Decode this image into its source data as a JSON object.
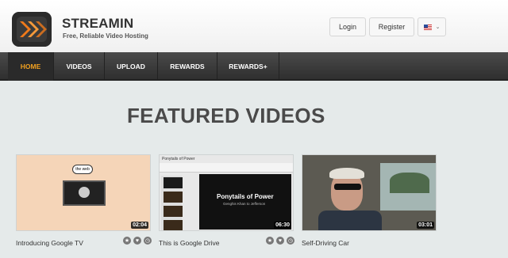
{
  "brand": {
    "name": "STREAMIN",
    "tagline": "Free, Reliable Video Hosting",
    "logo_colors": [
      "#2b2b2b",
      "#f07a1a"
    ]
  },
  "header": {
    "login_label": "Login",
    "register_label": "Register",
    "language_icon": "us-flag-icon"
  },
  "nav": {
    "items": [
      {
        "label": "HOME",
        "active": true
      },
      {
        "label": "VIDEOS",
        "active": false
      },
      {
        "label": "UPLOAD",
        "active": false
      },
      {
        "label": "REWARDS",
        "active": false
      },
      {
        "label": "REWARDS+",
        "active": false
      }
    ]
  },
  "featured": {
    "title": "FEATURED VIDEOS",
    "videos": [
      {
        "title": "Introducing Google TV",
        "duration": "02:04"
      },
      {
        "title": "This is Google Drive",
        "duration": "06:30"
      },
      {
        "title": "Self-Driving Car",
        "duration": "03:01"
      }
    ]
  },
  "thumbnails": {
    "t1_bubble": "the web",
    "t2_doc_title": "Ponytails of Power",
    "t2_main_title": "Ponytails of Power",
    "t2_main_sub": "Genghis Khan to Jefferson"
  },
  "card_icons": [
    "star-icon",
    "heart-icon",
    "clock-icon"
  ],
  "colors": {
    "accent": "#f0a020",
    "nav_bg": "#3a3a3a",
    "page_bg": "#e5eaea"
  }
}
